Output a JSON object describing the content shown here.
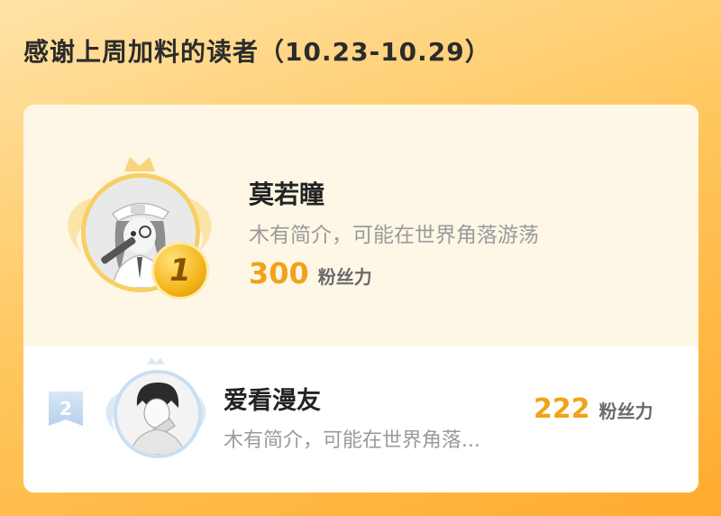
{
  "header": {
    "title": "感谢上周加料的读者（10.23-10.29）"
  },
  "ranking": [
    {
      "rank": "1",
      "name": "莫若瞳",
      "intro": "木有简介，可能在世界角落游荡",
      "fans": "300",
      "fans_unit": "粉丝力",
      "avatar_icon": "anime-girl-avatar",
      "medal_icon": "gold-medal-icon"
    },
    {
      "rank": "2",
      "name": "爱看漫友",
      "intro": "木有简介，可能在世界角落...",
      "fans": "222",
      "fans_unit": "粉丝力",
      "avatar_icon": "manga-boy-avatar",
      "badge_icon": "rank-badge-icon"
    }
  ],
  "colors": {
    "accent": "#f1a21a",
    "first_bg": "#fef7e6",
    "gold": "#f4b51c",
    "silver_blue": "#c9def2"
  }
}
